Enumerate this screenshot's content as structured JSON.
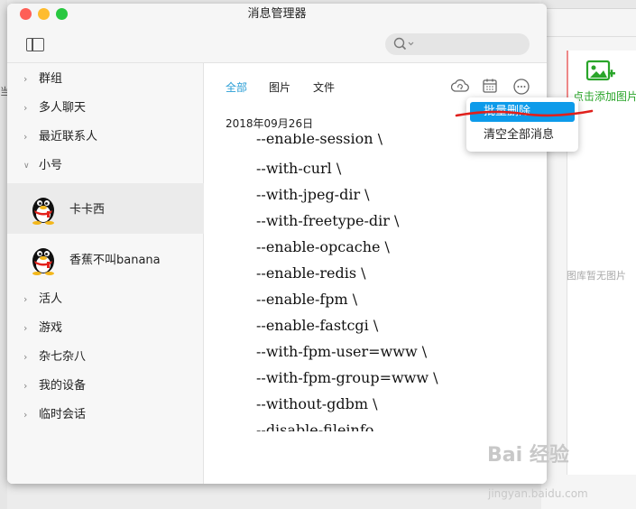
{
  "window": {
    "title": "消息管理器"
  },
  "search": {
    "placeholder": ""
  },
  "sidebar": {
    "groups_top": [
      {
        "label": "群组",
        "expanded": false
      },
      {
        "label": "多人聊天",
        "expanded": false
      },
      {
        "label": "最近联系人",
        "expanded": false
      },
      {
        "label": "小号",
        "expanded": true
      }
    ],
    "contacts": [
      {
        "name": "卡卡西",
        "selected": true
      },
      {
        "name": "香蕉不叫banana",
        "selected": false
      }
    ],
    "groups_bottom": [
      {
        "label": "活人"
      },
      {
        "label": "游戏"
      },
      {
        "label": "杂七杂八"
      },
      {
        "label": "我的设备"
      },
      {
        "label": "临时会话"
      }
    ]
  },
  "content": {
    "tabs": [
      {
        "label": "全部",
        "active": true
      },
      {
        "label": "图片",
        "active": false
      },
      {
        "label": "文件",
        "active": false
      }
    ],
    "date": "2018年09月26日",
    "code_lines": [
      "--enable-session  \\",
      "--with-curl  \\",
      "--with-jpeg-dir  \\",
      "--with-freetype-dir  \\",
      "--enable-opcache  \\",
      "--enable-redis  \\",
      "--enable-fpm  \\",
      "--enable-fastcgi  \\",
      "--with-fpm-user=www  \\",
      "--with-fpm-group=www  \\",
      "--without-gdbm  \\",
      "--disable-fileinfo"
    ]
  },
  "menu": {
    "items": [
      {
        "label": "批量删除",
        "highlighted": true
      },
      {
        "label": "清空全部消息",
        "highlighted": false
      }
    ]
  },
  "background_app": {
    "add_photo": "点击添加图片",
    "empty_gallery": "图库暂无图片",
    "left_label": "当"
  },
  "watermark": {
    "main": "Bai 经验",
    "sub": "jingyan.baidu.com"
  },
  "colors": {
    "accent": "#2a9ed6",
    "menu_highlight": "#0d9bea",
    "annotation_red": "#e0201c",
    "add_photo_green": "#2aa52a"
  }
}
